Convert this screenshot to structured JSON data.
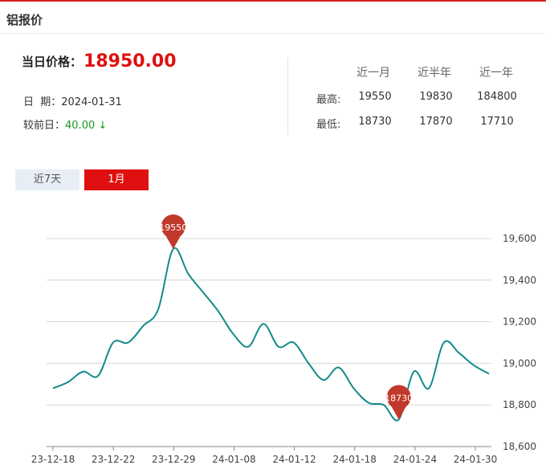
{
  "title": "铝报价",
  "price_label": "当日价格：",
  "price_value": "18950.00",
  "date_label": "日  期：",
  "date_value": "2024-01-31",
  "change_label": "较前日：",
  "change_value": "40.00 ↓",
  "stats": {
    "headers": [
      "近一月",
      "近半年",
      "近一年"
    ],
    "rows": [
      {
        "label": "最高:",
        "values": [
          "19550",
          "19830",
          "184800"
        ]
      },
      {
        "label": "最低:",
        "values": [
          "18730",
          "17870",
          "17710"
        ]
      }
    ]
  },
  "tabs": {
    "seven_day": "近7天",
    "one_month": "1月"
  },
  "colors": {
    "accent": "#e01010",
    "line": "#138a8a",
    "marker": "#c0392b",
    "down": "#1a9a1a"
  },
  "chart_data": {
    "type": "line",
    "x_ticks": [
      "23-12-18",
      "23-12-22",
      "23-12-29",
      "24-01-08",
      "24-01-12",
      "24-01-18",
      "24-01-24",
      "24-01-30"
    ],
    "y_ticks": [
      "19,600",
      "19,400",
      "19,200",
      "19,000",
      "18,800",
      "18,600"
    ],
    "ylim": [
      18600,
      19600
    ],
    "y_axis_position": "right",
    "grid": true,
    "series": [
      {
        "values": [
          18880,
          18910,
          18960,
          18940,
          19100,
          19100,
          19180,
          19260,
          19550,
          19430,
          19340,
          19250,
          19140,
          19080,
          19190,
          19080,
          19100,
          19000,
          18920,
          18980,
          18880,
          18810,
          18800,
          18730,
          18960,
          18880,
          19100,
          19050,
          18990,
          18950
        ]
      }
    ],
    "markers": [
      {
        "label": "19550",
        "index": 8,
        "value": 19550
      },
      {
        "label": "18730",
        "index": 23,
        "value": 18730
      }
    ]
  }
}
